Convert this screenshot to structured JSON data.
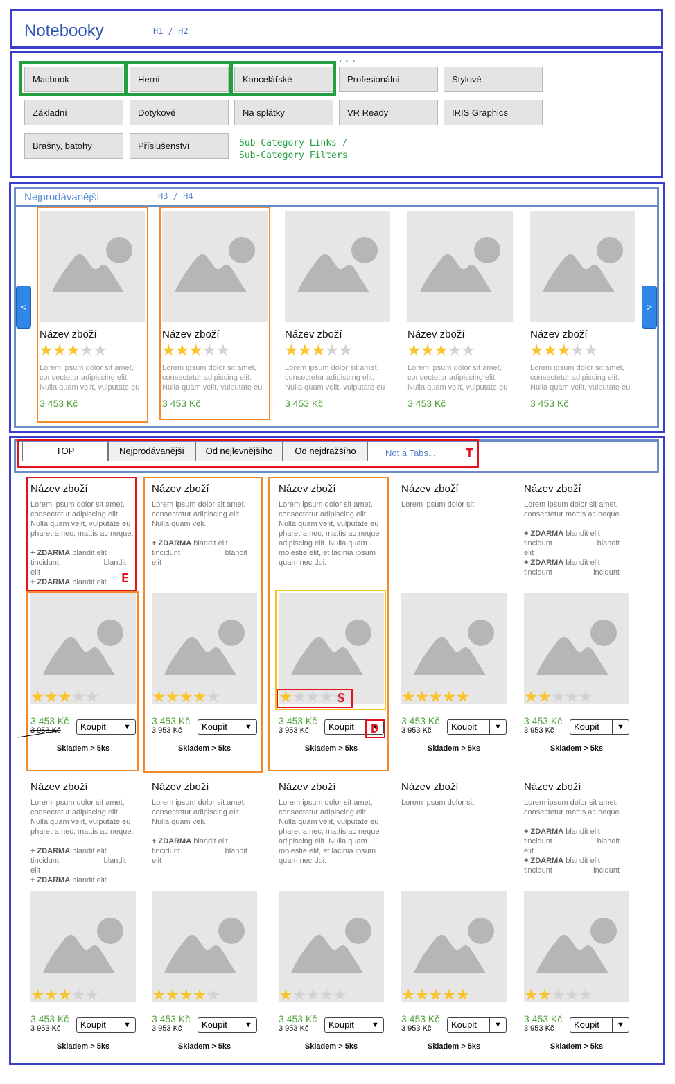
{
  "header": {
    "title": "Notebooky",
    "heading_note": "H1 / H2"
  },
  "categories": {
    "items": [
      "Macbook",
      "Herní",
      "Kancelářské",
      "Profesionální",
      "Stylové",
      "Základní",
      "Dotykové",
      "Na splátky",
      "VR Ready",
      "IRIS Graphics",
      "Brašny, batohy",
      "Příslušenství"
    ],
    "note_line1": "Sub-Category Links /",
    "note_line2": "Sub-Category Filters"
  },
  "bestsellers": {
    "title": "Nejprodávanější",
    "heading_note": "H3 / H4",
    "prev": "<",
    "next": ">",
    "products": [
      {
        "name": "Název zboží",
        "rating": 3,
        "desc1": "Lorem ipsum dolor sit amet,",
        "desc2": "consectetur adipiscing elit.",
        "desc3": "Nulla quam velit, vulputate eu",
        "price": "3 453 Kč"
      },
      {
        "name": "Název zboží",
        "rating": 3,
        "desc1": "Lorem ipsum dolor sit amet,",
        "desc2": "consectetur adipiscing elit.",
        "desc3": "Nulla quam velit, vulputate eu",
        "price": "3 453 Kč"
      },
      {
        "name": "Název zboží",
        "rating": 3,
        "desc1": "Lorem ipsum dolor sit amet,",
        "desc2": "consectetur adipiscing elit.",
        "desc3": "Nulla quam velit, vulputate eu",
        "price": "3 453 Kč"
      },
      {
        "name": "Název zboží",
        "rating": 3,
        "desc1": "Lorem ipsum dolor sit amet,",
        "desc2": "consectetur adipiscing elit.",
        "desc3": "Nulla quam velit, vulputate eu",
        "price": "3 453 Kč"
      },
      {
        "name": "Název zboží",
        "rating": 3,
        "desc1": "Lorem ipsum dolor sit amet,",
        "desc2": "consectetur adipiscing elit.",
        "desc3": "Nulla quam velit, vulputate eu",
        "price": "3 453 Kč"
      }
    ]
  },
  "listing": {
    "tabs": [
      "TOP",
      "Nejprodávanější",
      "Od nejlevnějšího",
      "Od nejdražšího"
    ],
    "tabs_note": "Not a Tabs...",
    "labels": {
      "T": "T",
      "E": "E",
      "S": "S",
      "D": "D"
    },
    "rows": [
      [
        {
          "name": "Název zboží",
          "desc": [
            "Lorem ipsum dolor sit amet,",
            "consectetur adipiscing elit.",
            "Nulla quam velit, vulputate eu",
            "pharetra nec, mattis ac neque."
          ],
          "extras": [
            [
              "+ ZDARMA",
              " blandit elit"
            ],
            [
              "tincidunt",
              "blandit"
            ],
            [
              "elit",
              ""
            ],
            [
              "+ ZDARMA",
              " blandit elit"
            ]
          ],
          "rating": 3,
          "price": "3 453 Kč",
          "old_price": "3 953 Kč",
          "buy": "Koupit",
          "stock": "Skladem > 5ks"
        },
        {
          "name": "Název zboží",
          "desc": [
            "Lorem ipsum dolor sit amet,",
            "consectetur adipiscing elit.",
            "Nulla quam veli."
          ],
          "extras": [
            [
              "+ ZDARMA",
              " blandit elit"
            ],
            [
              "tincidunt",
              "blandit"
            ],
            [
              "elit",
              ""
            ]
          ],
          "rating": 4,
          "price": "3 453 Kč",
          "old_price": "3 953 Kč",
          "buy": "Koupit",
          "stock": "Skladem > 5ks"
        },
        {
          "name": "Název zboží",
          "desc": [
            "Lorem ipsum dolor sit amet,",
            "consectetur adipiscing elit.",
            "Nulla quam velit, vulputate eu",
            "pharetra nec, mattis ac neque",
            "adipiscing elit. Nulla quam  .",
            "molestie elit, et lacinia ipsum",
            "quam nec dui."
          ],
          "extras": [],
          "rating": 1,
          "price": "3 453 Kč",
          "old_price": "3 953 Kč",
          "buy": "Koupit",
          "stock": "Skladem > 5ks"
        },
        {
          "name": "Název zboží",
          "desc": [
            "Lorem ipsum dolor sit"
          ],
          "extras": [],
          "rating": 5,
          "price": "3 453 Kč",
          "old_price": "3 953 Kč",
          "buy": "Koupit",
          "stock": "Skladem > 5ks"
        },
        {
          "name": "Název zboží",
          "desc": [
            "Lorem ipsum dolor sit amet,",
            "consectetur mattis ac neque."
          ],
          "extras": [
            [
              "+ ZDARMA",
              " blandit elit"
            ],
            [
              "tincidunt",
              "blandit"
            ],
            [
              "elit",
              ""
            ],
            [
              "+ ZDARMA",
              " blandit elit"
            ],
            [
              "tincidunt",
              "incidunt"
            ]
          ],
          "rating": 2,
          "price": "3 453 Kč",
          "old_price": "3 953 Kč",
          "buy": "Koupit",
          "stock": "Skladem > 5ks"
        }
      ],
      [
        {
          "name": "Název zboží",
          "desc": [
            "Lorem ipsum dolor sit amet,",
            "consectetur adipiscing elit.",
            "Nulla quam velit, vulputate eu",
            "pharetra nec, mattis ac neque."
          ],
          "extras": [
            [
              "+ ZDARMA",
              " blandit elit"
            ],
            [
              "tincidunt",
              "blandit"
            ],
            [
              "elit",
              ""
            ],
            [
              "+ ZDARMA",
              " blandit elit"
            ]
          ],
          "rating": 3,
          "price": "3 453 Kč",
          "old_price": "3 953 Kč",
          "buy": "Koupit",
          "stock": "Skladem > 5ks"
        },
        {
          "name": "Název zboží",
          "desc": [
            "Lorem ipsum dolor sit amet,",
            "consectetur adipiscing elit.",
            "Nulla quam veli."
          ],
          "extras": [
            [
              "+ ZDARMA",
              " blandit elit"
            ],
            [
              "tincidunt",
              "blandit"
            ],
            [
              "elit",
              ""
            ]
          ],
          "rating": 4,
          "price": "3 453 Kč",
          "old_price": "3 953 Kč",
          "buy": "Koupit",
          "stock": "Skladem > 5ks"
        },
        {
          "name": "Název zboží",
          "desc": [
            "Lorem ipsum dolor sit amet,",
            "consectetur adipiscing elit.",
            "Nulla quam velit, vulputate eu",
            "pharetra nec, mattis ac neque",
            "adipiscing elit. Nulla quam  .",
            "molestie elit, et lacinia ipsum",
            "quam nec dui."
          ],
          "extras": [],
          "rating": 1,
          "price": "3 453 Kč",
          "old_price": "3 953 Kč",
          "buy": "Koupit",
          "stock": "Skladem > 5ks"
        },
        {
          "name": "Název zboží",
          "desc": [
            "Lorem ipsum dolor sit"
          ],
          "extras": [],
          "rating": 5,
          "price": "3 453 Kč",
          "old_price": "3 953 Kč",
          "buy": "Koupit",
          "stock": "Skladem > 5ks"
        },
        {
          "name": "Název zboží",
          "desc": [
            "Lorem ipsum dolor sit amet,",
            "consectetur mattis ac neque."
          ],
          "extras": [
            [
              "+ ZDARMA",
              " blandit elit"
            ],
            [
              "tincidunt",
              "blandit"
            ],
            [
              "elit",
              ""
            ],
            [
              "+ ZDARMA",
              " blandit elit"
            ],
            [
              "tincidunt",
              "incidunt"
            ]
          ],
          "rating": 2,
          "price": "3 453 Kč",
          "old_price": "3 953 Kč",
          "buy": "Koupit",
          "stock": "Skladem > 5ks"
        }
      ]
    ]
  },
  "colors": {
    "frame": "#3a3ecb",
    "section_frame": "#6a8dc8",
    "price": "#4ea23a",
    "star": "#f9c52e",
    "accent_button": "#2f86e6"
  }
}
